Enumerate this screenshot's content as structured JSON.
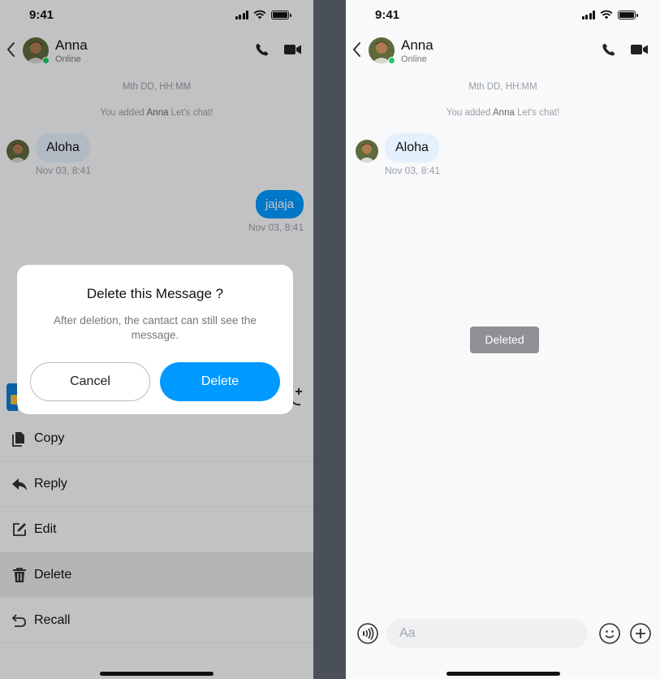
{
  "status": {
    "time": "9:41"
  },
  "contact": {
    "name": "Anna",
    "status": "Online"
  },
  "chat": {
    "timestamp_placeholder": "Mth DD, HH:MM",
    "added_prefix": "You added",
    "added_name": "Anna",
    "added_suffix": "Let's chat!",
    "incoming": {
      "text": "Aloha",
      "time": "Nov 03, 8:41"
    },
    "outgoing": {
      "text": "jajaja",
      "time": "Nov 03, 8:41"
    }
  },
  "menu": {
    "items": [
      {
        "label": "Copy",
        "icon": "copy-icon"
      },
      {
        "label": "Reply",
        "icon": "reply-icon"
      },
      {
        "label": "Edit",
        "icon": "edit-icon"
      },
      {
        "label": "Delete",
        "icon": "trash-icon"
      },
      {
        "label": "Recall",
        "icon": "recall-icon"
      }
    ]
  },
  "dialog": {
    "title": "Delete this Message ?",
    "body": "After deletion, the cantact can still see the message.",
    "cancel_label": "Cancel",
    "delete_label": "Delete"
  },
  "toast": {
    "text": "Deleted"
  },
  "composer": {
    "placeholder": "Aa"
  },
  "colors": {
    "accent": "#0099ff",
    "online": "#20c95f",
    "bubble_in": "#e4f0fc"
  }
}
